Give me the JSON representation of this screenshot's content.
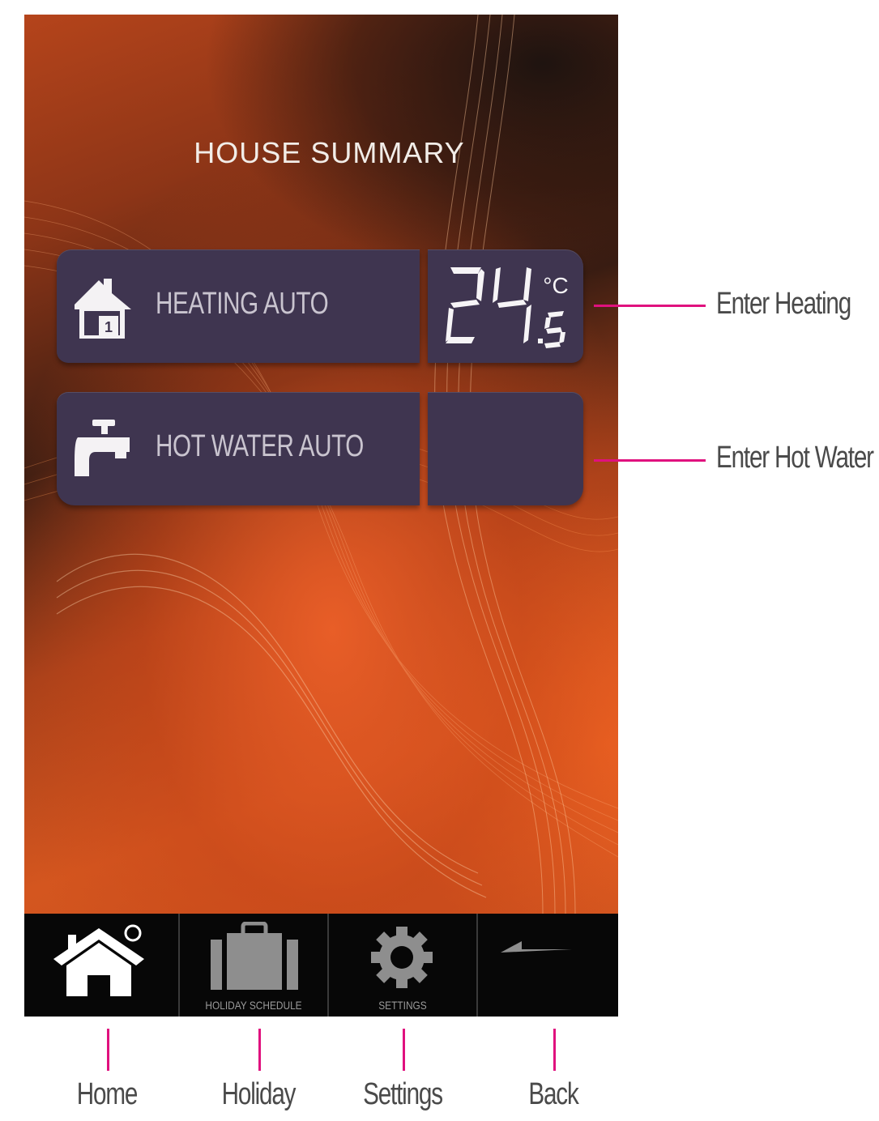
{
  "screen": {
    "title": "HOUSE SUMMARY"
  },
  "tiles": {
    "heating": {
      "label": "HEATING AUTO",
      "zone_number": "1",
      "temperature": "24",
      "temperature_decimal": ".5",
      "unit": "°C"
    },
    "hot_water": {
      "label": "HOT WATER AUTO"
    }
  },
  "nav": {
    "home": {
      "label": ""
    },
    "holiday": {
      "label": "HOLIDAY SCHEDULE"
    },
    "settings": {
      "label": "SETTINGS"
    },
    "back": {
      "label": ""
    }
  },
  "callouts": {
    "heating": "Enter Heating",
    "hot_water": "Enter Hot Water",
    "home": "Home",
    "holiday": "Holiday",
    "settings": "Settings",
    "back": "Back"
  },
  "colors": {
    "callout_accent": "#e0117e",
    "tile_bg": "#3f3550",
    "screen_orange": "#d4561f"
  }
}
